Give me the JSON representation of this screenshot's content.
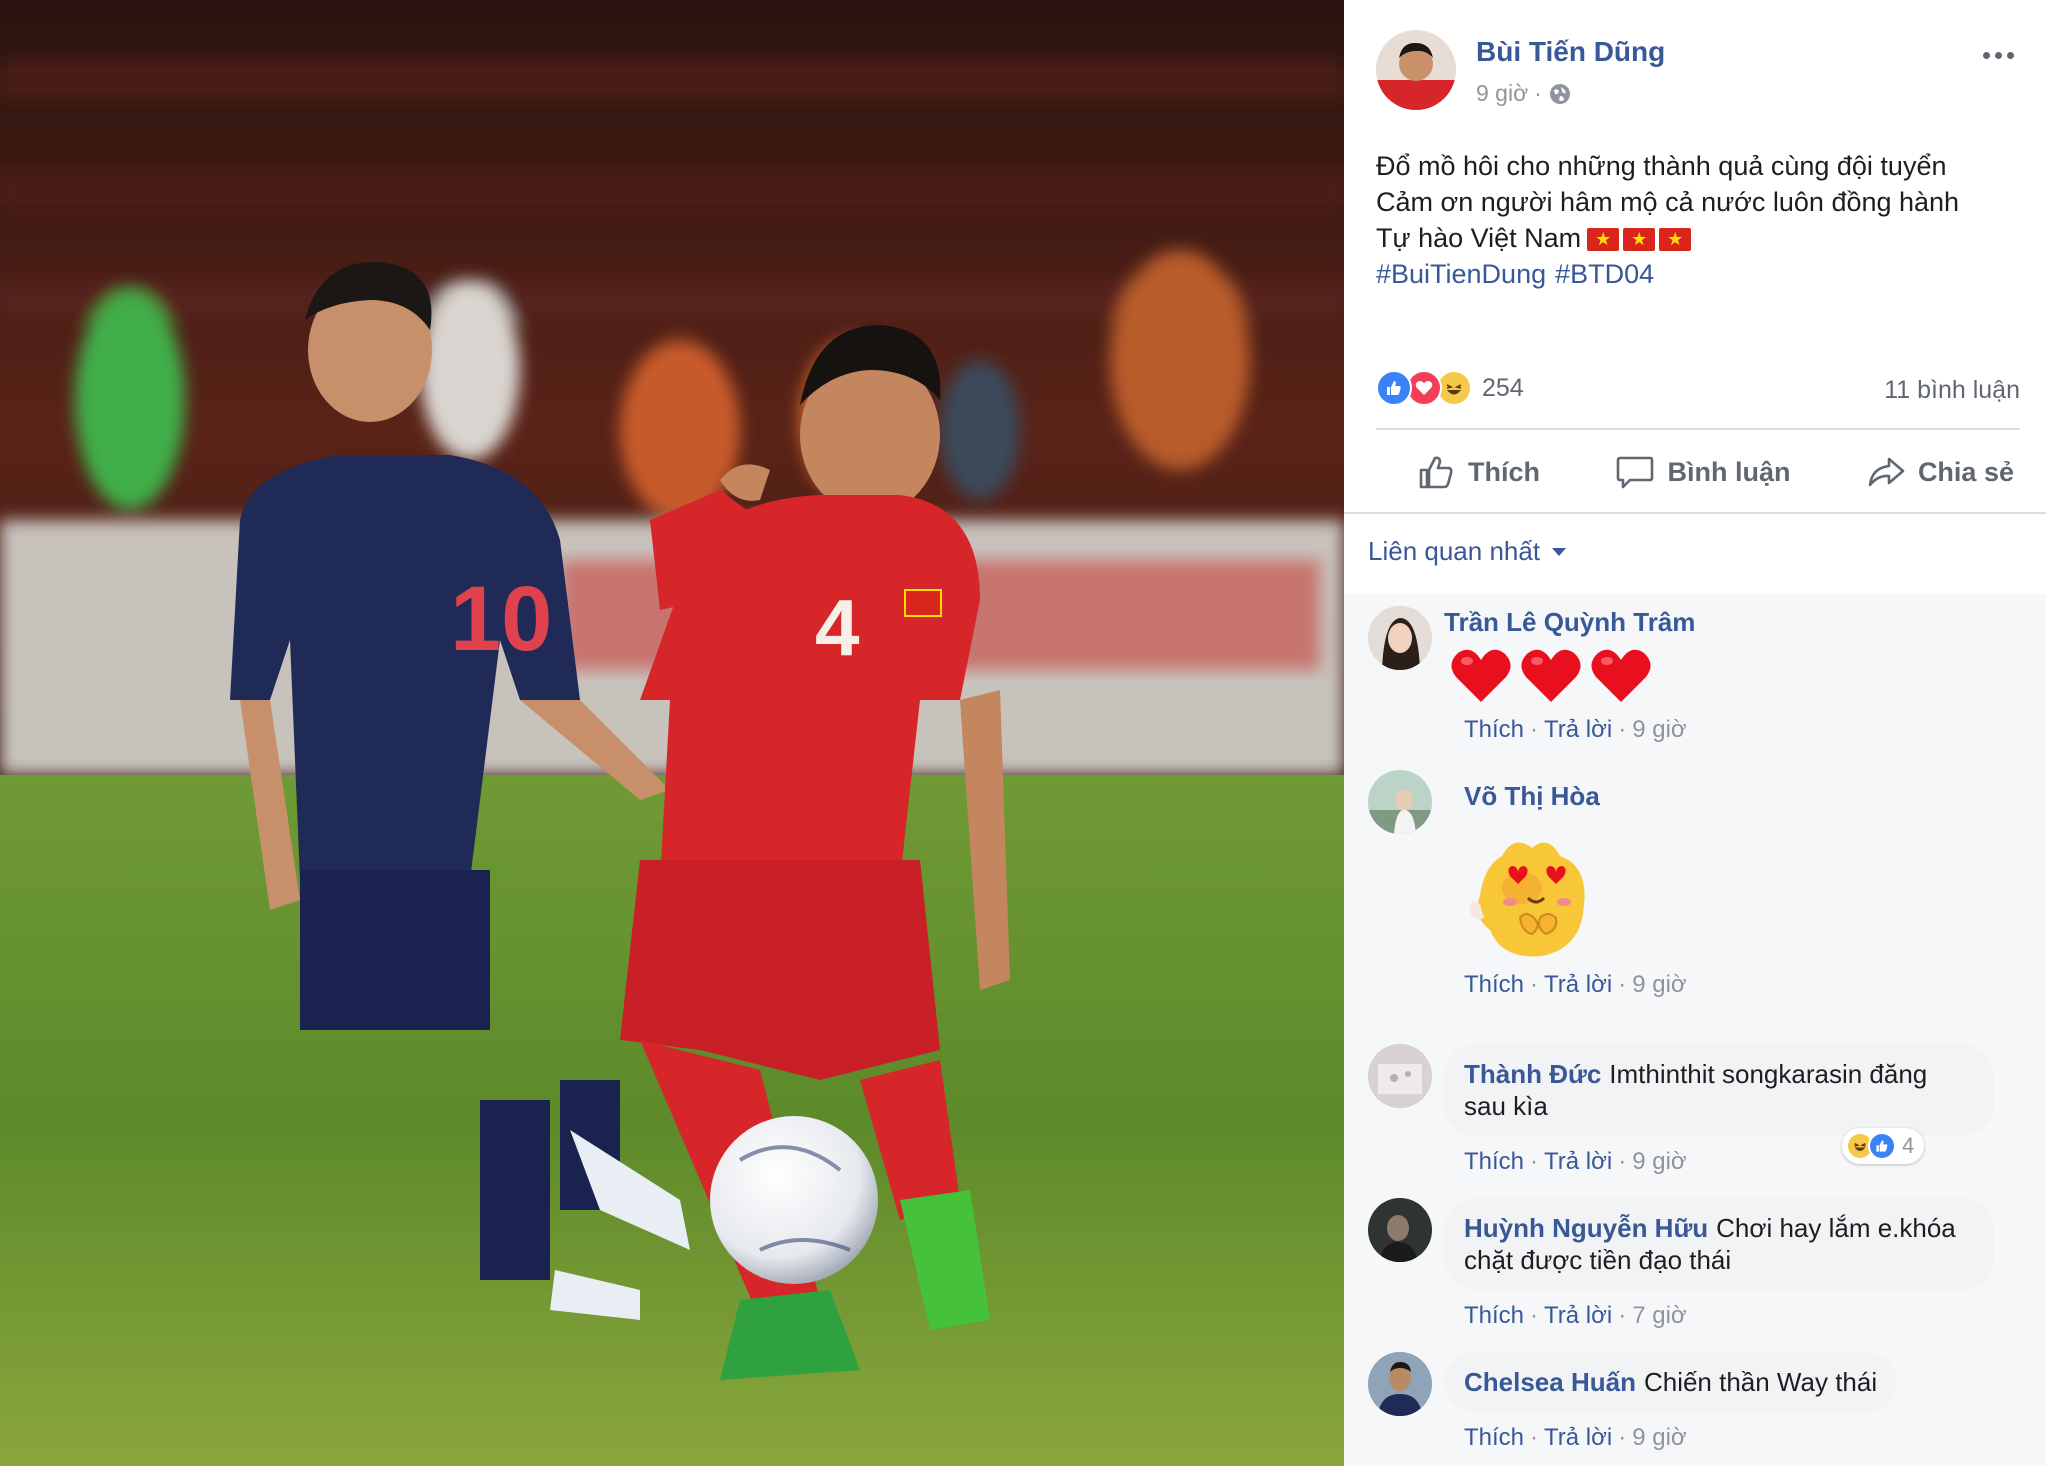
{
  "photo": {
    "alt": "",
    "jersey_numbers": {
      "thai_player": "10",
      "vietnam_player": "4"
    }
  },
  "post": {
    "author": "Bùi Tiến Dũng",
    "time": "9 giờ",
    "separator": "·",
    "lines": [
      "Đổ mồ hôi cho những thành quả cùng đội tuyển",
      "Cảm ơn người hâm mộ cả nước luôn đồng hành",
      "Tự hào Việt Nam"
    ],
    "hashtags": [
      "#BuiTienDung",
      "#BTD04"
    ],
    "reactions": {
      "count": "254",
      "types": [
        "like-icon",
        "love-icon",
        "haha-icon"
      ]
    },
    "comment_count": "11 bình luận"
  },
  "actions": {
    "like": "Thích",
    "comment": "Bình luận",
    "share": "Chia sẻ"
  },
  "sort": {
    "label": "Liên quan nhất"
  },
  "comment_actions": {
    "like": "Thích",
    "reply": "Trả lời",
    "separator": "·"
  },
  "comments": [
    {
      "name": "Trần Lê Quỳnh Trâm",
      "text": "",
      "content": "three-heart-emoji",
      "time": "9 giờ"
    },
    {
      "name": "Võ Thị Hòa",
      "text": "",
      "content": "sticker",
      "time": "9 giờ"
    },
    {
      "name": "Thành Đức",
      "text_line1": "Imthinthit songkarasin đăng",
      "text_line2": "sau kìa",
      "time": "9 giờ",
      "reaction_count": "4"
    },
    {
      "name": "Huỳnh Nguyễn Hữu",
      "text_line1": "Chơi hay lắm e.khóa",
      "text_line2": "chặt được tiền đạo thái",
      "time": "7 giờ"
    },
    {
      "name": "Chelsea Huấn",
      "text": "Chiến thần Way thái",
      "time": "9 giờ"
    }
  ],
  "colors": {
    "link": "#385898",
    "muted": "#90949c",
    "bubble": "#f2f3f5",
    "comments_bg": "#f6f7f9",
    "vietnam_red": "#d7262a",
    "thai_navy": "#1f2a57",
    "pitch_green": "#5b8a2c"
  }
}
